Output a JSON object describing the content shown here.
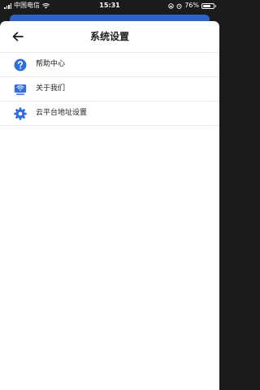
{
  "status_bar": {
    "carrier": "中国电信",
    "time": "15:31",
    "battery_percent": "76%",
    "battery_level": 0.76
  },
  "nav": {
    "title": "系统设置",
    "back_icon": "arrow-left-icon"
  },
  "menu": {
    "items": [
      {
        "label": "帮助中心",
        "icon": "help-circle-icon"
      },
      {
        "label": "关于我们",
        "icon": "about-monitor-icon"
      },
      {
        "label": "云平台地址设置",
        "icon": "gear-icon"
      }
    ]
  },
  "colors": {
    "icon_blue": "#2f6cdc",
    "background_card": "#2f62c8",
    "text": "#222222",
    "divider": "#ececec"
  }
}
